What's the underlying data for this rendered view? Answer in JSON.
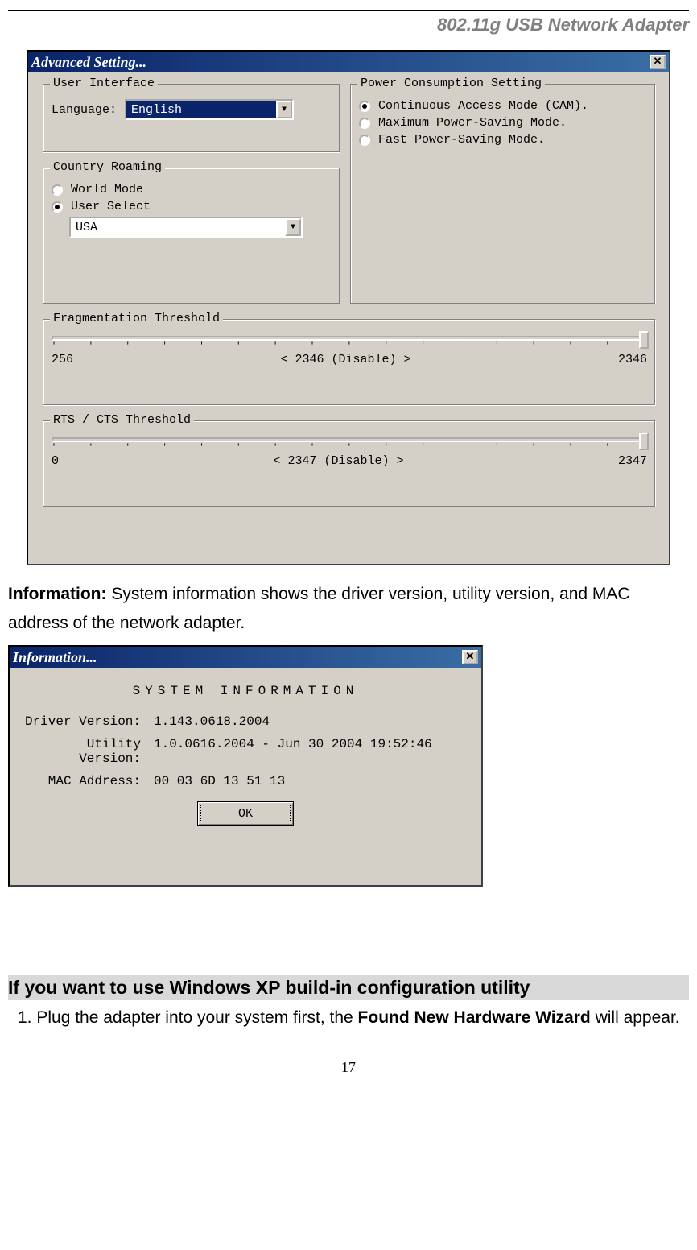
{
  "header": "802.11g USB Network Adapter",
  "advanced": {
    "title": "Advanced Setting...",
    "close": "✕",
    "ui": {
      "legend": "User Interface",
      "lang_label": "Language:",
      "lang_value": "English"
    },
    "roam": {
      "legend": "Country Roaming",
      "opt1": "World Mode",
      "opt2": "User Select",
      "country": "USA"
    },
    "power": {
      "legend": "Power Consumption Setting",
      "opt1": "Continuous Access Mode (CAM).",
      "opt2": "Maximum Power-Saving Mode.",
      "opt3": "Fast Power-Saving Mode."
    },
    "frag": {
      "legend": "Fragmentation Threshold",
      "min": "256",
      "mid": "< 2346 (Disable) >",
      "max": "2346"
    },
    "rts": {
      "legend": "RTS / CTS Threshold",
      "min": "0",
      "mid": "< 2347 (Disable) >",
      "max": "2347"
    }
  },
  "para1_label": "Information:",
  "para1_text": " System information shows the driver version, utility version, and MAC address of the network adapter.",
  "info": {
    "title": "Information...",
    "close": "✕",
    "heading": "SYSTEM INFORMATION",
    "driver_lbl": "Driver Version:",
    "driver_val": "1.143.0618.2004",
    "util_lbl": "Utility Version:",
    "util_val": "1.0.0616.2004 - Jun 30 2004 19:52:46",
    "mac_lbl": "MAC Address:",
    "mac_val": "00 03 6D 13 51 13",
    "ok": "OK"
  },
  "section_hdr": "If you want to use Windows XP build-in configuration utility",
  "step1_prefix": "1.  Plug the adapter into your system first, the ",
  "step1_bold": "Found New Hardware Wizard",
  "step1_suffix": " will appear.",
  "page_num": "17"
}
